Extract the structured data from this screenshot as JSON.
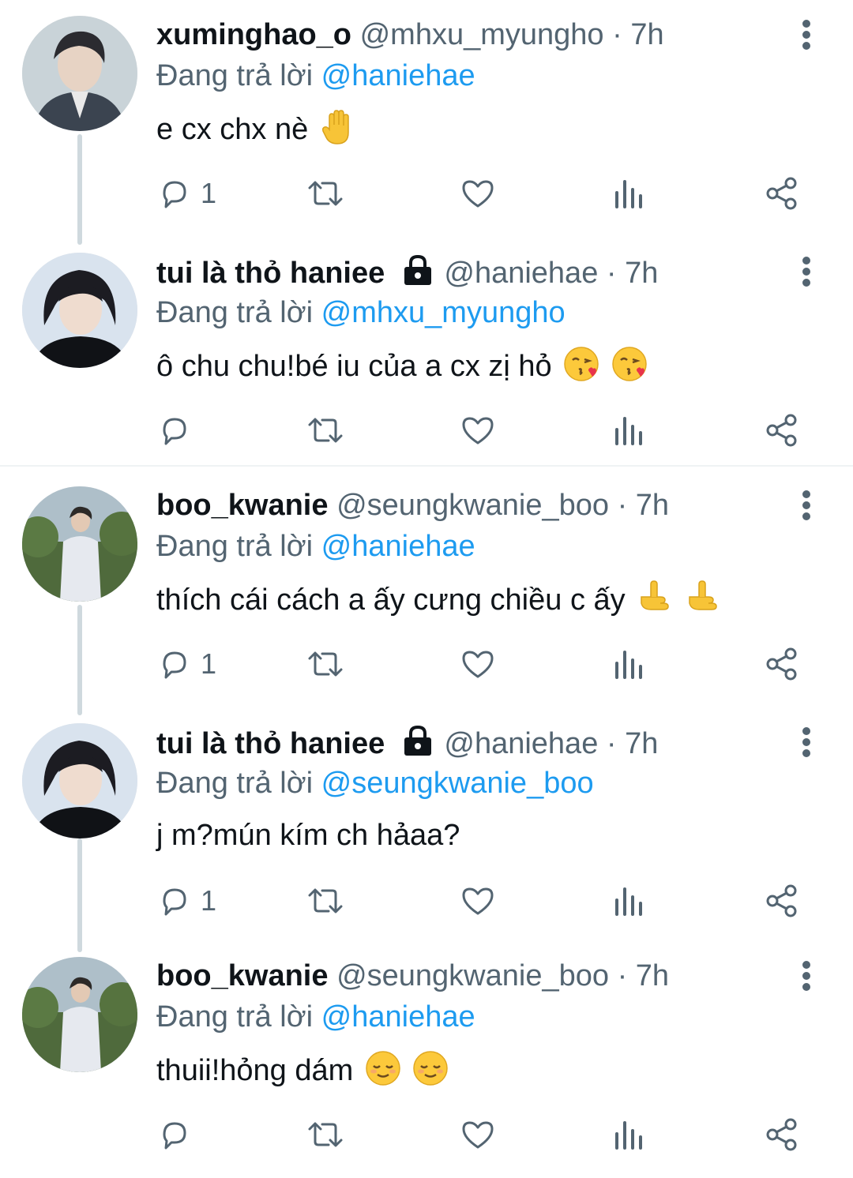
{
  "colors": {
    "link": "#1d9bf0",
    "secondary_text": "#536471",
    "primary_text": "#0f1419",
    "thread_line": "#cfd9de"
  },
  "tweets": [
    {
      "display_name": "xuminghao_o",
      "handle": "@mhxu_myungho",
      "dot": "·",
      "time": "7h",
      "replying_prefix": "Đang trả lời",
      "replying_to": "@haniehae",
      "text": "e cx chx nè",
      "emojis": [
        "raised-hand-emoji"
      ],
      "reply_count": "1",
      "protected": false
    },
    {
      "display_name": "tui là thỏ haniee",
      "handle": "@haniehae",
      "dot": "·",
      "time": "7h",
      "replying_prefix": "Đang trả lời",
      "replying_to": "@mhxu_myungho",
      "text": "ô chu chu!bé iu của a cx zị hỏ",
      "emojis": [
        "face-blowing-kiss-emoji",
        "face-blowing-kiss-emoji"
      ],
      "reply_count": "",
      "protected": true
    },
    {
      "display_name": "boo_kwanie",
      "handle": "@seungkwanie_boo",
      "dot": "·",
      "time": "7h",
      "replying_prefix": "Đang trả lời",
      "replying_to": "@haniehae",
      "text": "thích cái cách a ấy cưng chiều c ấy",
      "emojis": [
        "pointing-finger-emoji",
        "pointing-finger-emoji"
      ],
      "reply_count": "1",
      "protected": false
    },
    {
      "display_name": "tui là thỏ haniee",
      "handle": "@haniehae",
      "dot": "·",
      "time": "7h",
      "replying_prefix": "Đang trả lời",
      "replying_to": "@seungkwanie_boo",
      "text": "j m?mún kím ch hảaa?",
      "emojis": [],
      "reply_count": "1",
      "protected": true
    },
    {
      "display_name": "boo_kwanie",
      "handle": "@seungkwanie_boo",
      "dot": "·",
      "time": "7h",
      "replying_prefix": "Đang trả lời",
      "replying_to": "@haniehae",
      "text": "thuii!hỏng dám",
      "emojis": [
        "relieved-face-emoji",
        "relieved-face-emoji"
      ],
      "reply_count": "",
      "protected": false
    }
  ]
}
